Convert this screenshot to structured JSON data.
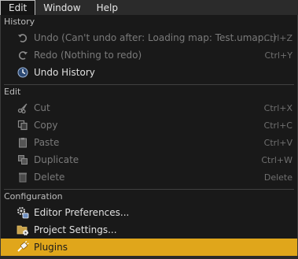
{
  "menubar": {
    "items": [
      {
        "label": "Edit"
      },
      {
        "label": "Window"
      },
      {
        "label": "Help"
      }
    ]
  },
  "sections": {
    "history": {
      "header": "History",
      "items": [
        {
          "label": "Undo (Can't undo after: Loading map: Test.umap...)",
          "shortcut": "Ctrl+Z",
          "icon": "undo-icon"
        },
        {
          "label": "Redo (Nothing to redo)",
          "shortcut": "Ctrl+Y",
          "icon": "redo-icon"
        },
        {
          "label": "Undo History",
          "icon": "undo-history-icon"
        }
      ]
    },
    "edit": {
      "header": "Edit",
      "items": [
        {
          "label": "Cut",
          "shortcut": "Ctrl+X",
          "icon": "scissors-icon"
        },
        {
          "label": "Copy",
          "shortcut": "Ctrl+C",
          "icon": "copy-icon"
        },
        {
          "label": "Paste",
          "shortcut": "Ctrl+V",
          "icon": "paste-icon"
        },
        {
          "label": "Duplicate",
          "shortcut": "Ctrl+W",
          "icon": "duplicate-icon"
        },
        {
          "label": "Delete",
          "shortcut": "Delete",
          "icon": "delete-icon"
        }
      ]
    },
    "configuration": {
      "header": "Configuration",
      "items": [
        {
          "label": "Editor Preferences...",
          "icon": "editor-preferences-icon"
        },
        {
          "label": "Project Settings...",
          "icon": "project-settings-icon"
        },
        {
          "label": "Plugins",
          "icon": "plugins-icon"
        }
      ]
    }
  },
  "colors": {
    "highlight": "#e0a61b",
    "background": "#191919",
    "menubar": "#2b2b2b"
  }
}
